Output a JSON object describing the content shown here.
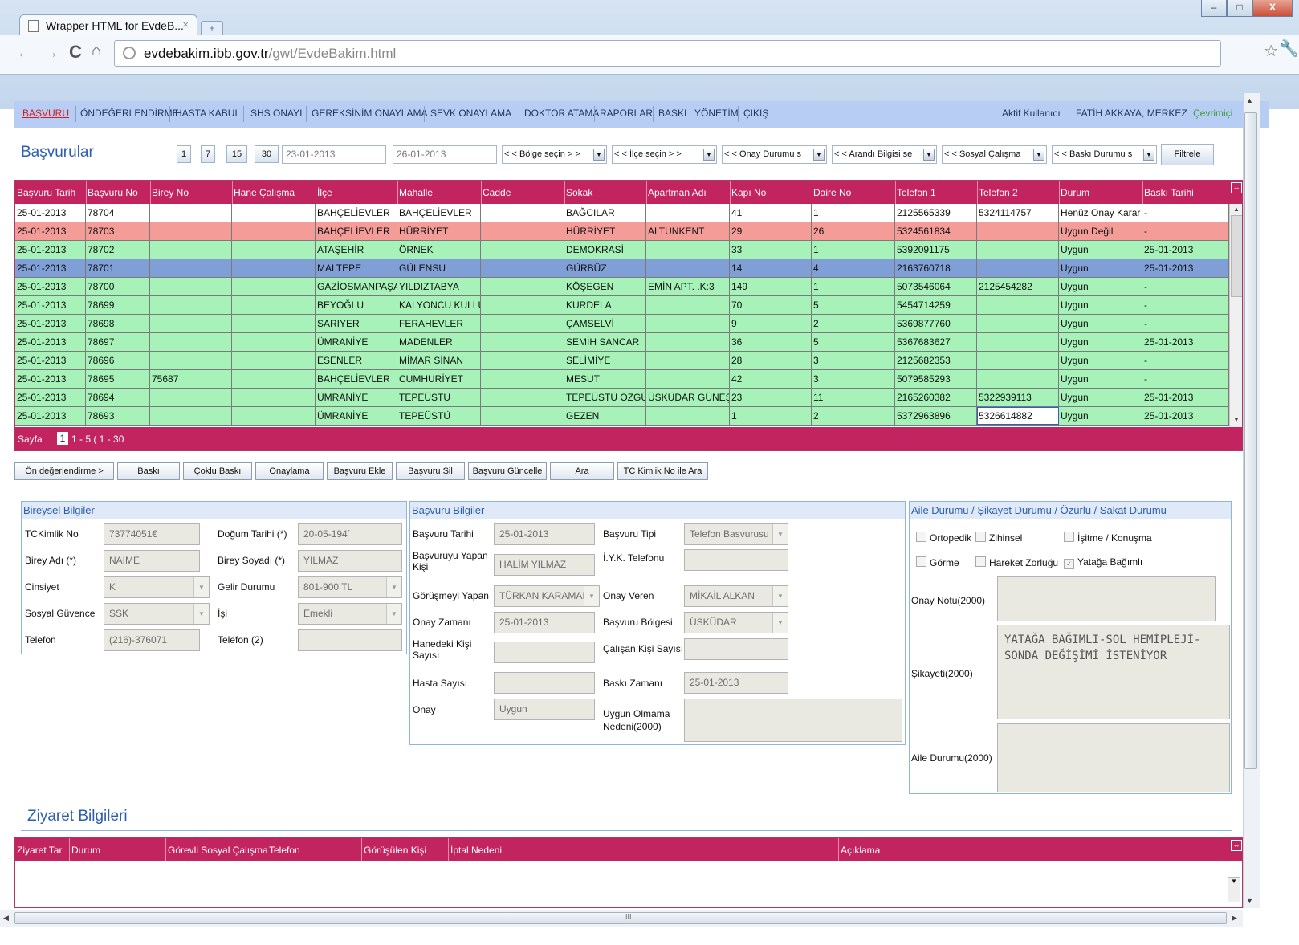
{
  "browser": {
    "tab_title": "Wrapper HTML for EvdeB...",
    "url_host": "evdebakim.ibb.gov.tr",
    "url_path": "/gwt/EvdeBakim.html",
    "window_min": "–",
    "window_max": "□",
    "window_close": "X"
  },
  "menu": {
    "items": [
      "BAŞVURU",
      "ÖNDEĞERLENDİRME",
      "HASTA KABUL",
      "SHS ONAYI",
      "GEREKSİNİM ONAYLAMA",
      "SEVK ONAYLAMA",
      "DOKTOR ATAMA",
      "RAPORLAR",
      "BASKI",
      "YÖNETİM",
      "ÇIKIŞ"
    ],
    "active_user_label": "Aktif Kullanıcı",
    "user_name": "FATİH AKKAYA, MERKEZ",
    "status": "Çevrimiçi"
  },
  "basvurular": {
    "title": "Başvurular",
    "day_buttons": [
      "1",
      "7",
      "15",
      "30"
    ],
    "date_from": "23-01-2013",
    "date_to": "26-01-2013",
    "filters": [
      "< < Bölge seçin > >",
      "< < İlçe seçin > >",
      "< < Onay Durumu s",
      "< < Arandı Bilgisi se",
      "< < Sosyal Çalışma",
      "< < Baskı Durumu s"
    ],
    "filter_button": "Filtrele"
  },
  "grid": {
    "columns": [
      "Başvuru Tarih",
      "Başvuru No",
      "Birey No",
      "Hane Çalışma",
      "İlçe",
      "Mahalle",
      "Cadde",
      "Sokak",
      "Apartman Adı",
      "Kapı No",
      "Daire No",
      "Telefon 1",
      "Telefon 2",
      "Durum",
      "Baskı Tarihi"
    ],
    "rows": [
      {
        "c": [
          "25-01-2013",
          "78704",
          "",
          "",
          "BAHÇELİEVLER",
          "BAHÇELİEVLER",
          "",
          "BAĞCILAR",
          "",
          "41",
          "1",
          "2125565339",
          "5324114757",
          "Henüz Onay Karar",
          "-"
        ],
        "status": "white"
      },
      {
        "c": [
          "25-01-2013",
          "78703",
          "",
          "",
          "BAHÇELİEVLER",
          "HÜRRİYET",
          "",
          "HÜRRİYET",
          "ALTUNKENT",
          "29",
          "26",
          "5324561834",
          "",
          "Uygun Değil",
          "-"
        ],
        "status": "red"
      },
      {
        "c": [
          "25-01-2013",
          "78702",
          "",
          "",
          "ATAŞEHİR",
          "ÖRNEK",
          "",
          "DEMOKRASİ",
          "",
          "33",
          "1",
          "5392091175",
          "",
          "Uygun",
          "25-01-2013"
        ],
        "status": "green"
      },
      {
        "c": [
          "25-01-2013",
          "78701",
          "",
          "",
          "MALTEPE",
          "GÜLENSU",
          "",
          "GÜRBÜZ",
          "",
          "14",
          "4",
          "2163760718",
          "",
          "Uygun",
          "25-01-2013"
        ],
        "status": "blue"
      },
      {
        "c": [
          "25-01-2013",
          "78700",
          "",
          "",
          "GAZİOSMANPAŞA",
          "YILDIZTABYA",
          "",
          "KÖŞEGEN",
          "EMİN APT. .K:3",
          "149",
          "1",
          "5073546064",
          "2125454282",
          "Uygun",
          "-"
        ],
        "status": "green"
      },
      {
        "c": [
          "25-01-2013",
          "78699",
          "",
          "",
          "BEYOĞLU",
          "KALYONCU KULLU",
          "",
          "KURDELA",
          "",
          "70",
          "5",
          "5454714259",
          "",
          "Uygun",
          "-"
        ],
        "status": "green"
      },
      {
        "c": [
          "25-01-2013",
          "78698",
          "",
          "",
          "SARIYER",
          "FERAHEVLER",
          "",
          "ÇAMSELVİ",
          "",
          "9",
          "2",
          "5369877760",
          "",
          "Uygun",
          "-"
        ],
        "status": "green"
      },
      {
        "c": [
          "25-01-2013",
          "78697",
          "",
          "",
          "ÜMRANİYE",
          "MADENLER",
          "",
          "SEMİH SANCAR",
          "",
          "36",
          "5",
          "5367683627",
          "",
          "Uygun",
          "25-01-2013"
        ],
        "status": "green"
      },
      {
        "c": [
          "25-01-2013",
          "78696",
          "",
          "",
          "ESENLER",
          "MİMAR SİNAN",
          "",
          "SELİMİYE",
          "",
          "28",
          "3",
          "2125682353",
          "",
          "Uygun",
          "-"
        ],
        "status": "green"
      },
      {
        "c": [
          "25-01-2013",
          "78695",
          "75687",
          "",
          "BAHÇELİEVLER",
          "CUMHURİYET",
          "",
          "MESUT",
          "",
          "42",
          "3",
          "5079585293",
          "",
          "Uygun",
          "-"
        ],
        "status": "green"
      },
      {
        "c": [
          "25-01-2013",
          "78694",
          "",
          "",
          "ÜMRANİYE",
          "TEPEÜSTÜ",
          "",
          "TEPEÜSTÜ ÖZGÜR",
          "ÜSKÜDAR GÜNEŞ",
          "23",
          "11",
          "2165260382",
          "5322939113",
          "Uygun",
          "25-01-2013"
        ],
        "status": "green"
      },
      {
        "c": [
          "25-01-2013",
          "78693",
          "",
          "",
          "ÜMRANİYE",
          "TEPEÜSTÜ",
          "",
          "GEZEN",
          "",
          "1",
          "2",
          "5372963896",
          "5326614882",
          "Uygun",
          "25-01-2013"
        ],
        "status": "green"
      }
    ],
    "footer_label": "Sayfa",
    "footer_page": "1",
    "footer_range": "1 - 5 ( 1 - 30"
  },
  "actions": [
    "Ön değerlendirme >",
    "Baskı",
    "Çoklu Baskı",
    "Onaylama",
    "Başvuru Ekle",
    "Başvuru Sil",
    "Başvuru Güncelle",
    "Ara",
    "TC Kimlik No ile Ara"
  ],
  "bireysel": {
    "title": "Bireysel Bilgiler",
    "tc_label": "TCKimlik No",
    "tc_value": "73774051€",
    "dogum_label": "Doğum Tarihi (*)",
    "dogum_value": "20-05-194´",
    "ad_label": "Birey Adı (*)",
    "ad_value": "NAİME",
    "soyad_label": "Birey Soyadı (*)",
    "soyad_value": "YILMAZ",
    "cinsiyet_label": "Cinsiyet",
    "cinsiyet_value": "K",
    "gelir_label": "Gelir Durumu",
    "gelir_value": "801-900 TL",
    "guvence_label": "Sosyal Güvence",
    "guvence_value": "SSK",
    "isi_label": "İşi",
    "isi_value": "Emekli",
    "tel_label": "Telefon",
    "tel_value": "(216)-376071",
    "tel2_label": "Telefon (2)",
    "tel2_value": ""
  },
  "basvuru": {
    "title": "Başvuru Bilgiler",
    "tarih_label": "Başvuru Tarihi",
    "tarih_value": "25-01-2013",
    "tipi_label": "Başvuru Tipi",
    "tipi_value": "Telefon Basvurusu",
    "yapan_label": "Başvuruyu Yapan Kişi",
    "yapan_value": "HALİM YILMAZ",
    "iyk_label": "İ.Y.K. Telefonu",
    "iyk_value": "",
    "gorusme_label": "Görüşmeyi Yapan",
    "gorusme_value": "TÜRKAN KARAMAI",
    "onayveren_label": "Onay Veren",
    "onayveren_value": "MİKAİL ALKAN",
    "onayzaman_label": "Onay Zamanı",
    "onayzaman_value": "25-01-2013",
    "bolge_label": "Başvuru Bölgesi",
    "bolge_value": "ÜSKÜDAR",
    "hane_label": "Hanedeki Kişi Sayısı",
    "hane_value": "",
    "calisan_label": "Çalışan Kişi Sayısı",
    "calisan_value": "",
    "hasta_label": "Hasta Sayısı",
    "hasta_value": "",
    "baski_label": "Baskı Zamanı",
    "baski_value": "25-01-2013",
    "onay_label": "Onay",
    "onay_value": "Uygun",
    "uygun_label": "Uygun Olmama Nedeni(2000)",
    "uygun_value": ""
  },
  "aile": {
    "title": "Aile Durumu / Şikayet Durumu / Özürlü / Sakat Durumu",
    "checks": [
      {
        "label": "Ortopedik",
        "checked": false
      },
      {
        "label": "Zihinsel",
        "checked": false
      },
      {
        "label": "İşitme / Konuşma",
        "checked": false
      },
      {
        "label": "Görme",
        "checked": false
      },
      {
        "label": "Hareket Zorluğu",
        "checked": false
      },
      {
        "label": "Yatağa Bağımlı",
        "checked": true
      }
    ],
    "onay_notu_label": "Onay Notu(2000)",
    "onay_notu_value": "",
    "sikayet_label": "Şikayeti(2000)",
    "sikayet_value": "YATAĞA BAĞIMLI-SOL HEMİPLEJİ-\nSONDA DEĞİŞİMİ İSTENİYOR",
    "aile_label": "Aile Durumu(2000)",
    "aile_value": ""
  },
  "ziyaret": {
    "title": "Ziyaret Bilgileri",
    "columns": [
      "Ziyaret Tar",
      "Durum",
      "Görevli Sosyal Çalışma",
      "Telefon",
      "Görüşülen Kişi",
      "İptal Nedeni",
      "Açıklama"
    ]
  },
  "colors": {
    "grid_header": "#c2245f",
    "row_green": "#a6f2b8",
    "row_red": "#f39c98",
    "row_blue": "#7f9fd6",
    "menu_bg": "#b7cdf4"
  },
  "hscroll_mark": "III"
}
